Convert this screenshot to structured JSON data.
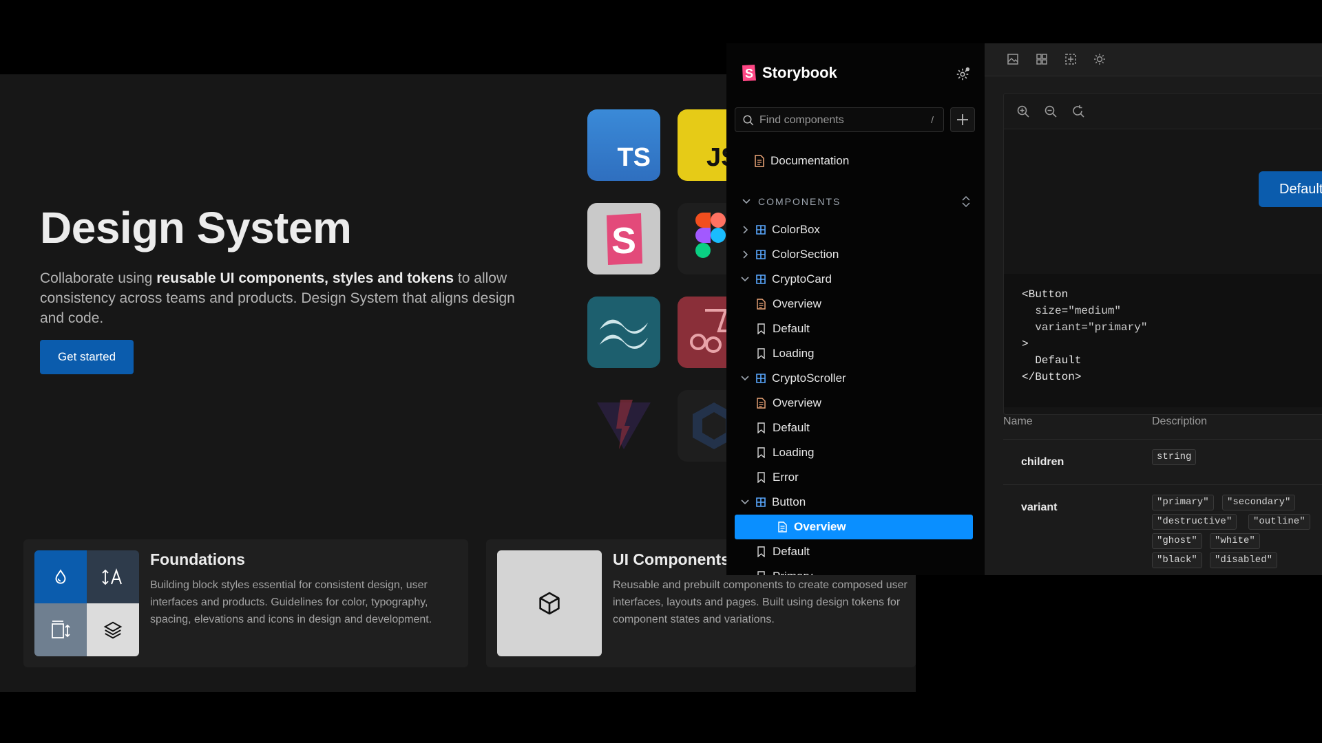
{
  "hero": {
    "title": "Design System",
    "desc_pre": "Collaborate using ",
    "desc_bold": "reusable UI components, styles and tokens",
    "desc_post": " to allow consistency across teams and products. Design System that aligns design and code.",
    "cta": "Get started"
  },
  "tiles": {
    "ts": "TS",
    "js": "JS"
  },
  "cards": [
    {
      "title": "Foundations",
      "desc": "Building block styles essential for consistent design, user interfaces and products. Guidelines for color, typography, spacing, elevations and icons in design and development."
    },
    {
      "title": "UI Components",
      "desc": "Reusable and prebuilt components to create composed user interfaces, layouts and pages. Built using design tokens for component states and variations."
    }
  ],
  "sidebar": {
    "brand": "Storybook",
    "search_placeholder": "Find components",
    "search_shortcut": "/",
    "docs_item": "Documentation",
    "section": "COMPONENTS",
    "items": [
      {
        "label": "ColorBox",
        "kind": "component",
        "state": "collapsed"
      },
      {
        "label": "ColorSection",
        "kind": "component",
        "state": "collapsed"
      },
      {
        "label": "CryptoCard",
        "kind": "component",
        "state": "expanded"
      },
      {
        "label": "Overview",
        "kind": "doc"
      },
      {
        "label": "Default",
        "kind": "story"
      },
      {
        "label": "Loading",
        "kind": "story"
      },
      {
        "label": "CryptoScroller",
        "kind": "component",
        "state": "expanded"
      },
      {
        "label": "Overview",
        "kind": "doc"
      },
      {
        "label": "Default",
        "kind": "story"
      },
      {
        "label": "Loading",
        "kind": "story"
      },
      {
        "label": "Error",
        "kind": "story"
      },
      {
        "label": "Button",
        "kind": "component",
        "state": "expanded"
      },
      {
        "label": "Overview",
        "kind": "doc",
        "selected": true
      },
      {
        "label": "Default",
        "kind": "story"
      },
      {
        "label": "Primary",
        "kind": "story"
      }
    ]
  },
  "preview": {
    "demo_button": "Default",
    "code": {
      "l1": "<Button",
      "l2": "  size=\"medium\"",
      "l3": "  variant=\"primary\"",
      "l4": ">",
      "l5": "  Default",
      "l6": "</Button>"
    },
    "props_header": {
      "name": "Name",
      "description": "Description"
    },
    "props": [
      {
        "name": "children",
        "types": [
          "string"
        ]
      },
      {
        "name": "variant",
        "types": [
          "\"primary\"",
          "\"secondary\"",
          "\"destructive\"",
          "\"outline\"",
          "\"ghost\"",
          "\"white\"",
          "\"black\"",
          "\"disabled\""
        ]
      }
    ]
  },
  "colors": {
    "accent": "#0a8fff",
    "cta": "#0b5cad",
    "storybook": "#ff4785"
  }
}
